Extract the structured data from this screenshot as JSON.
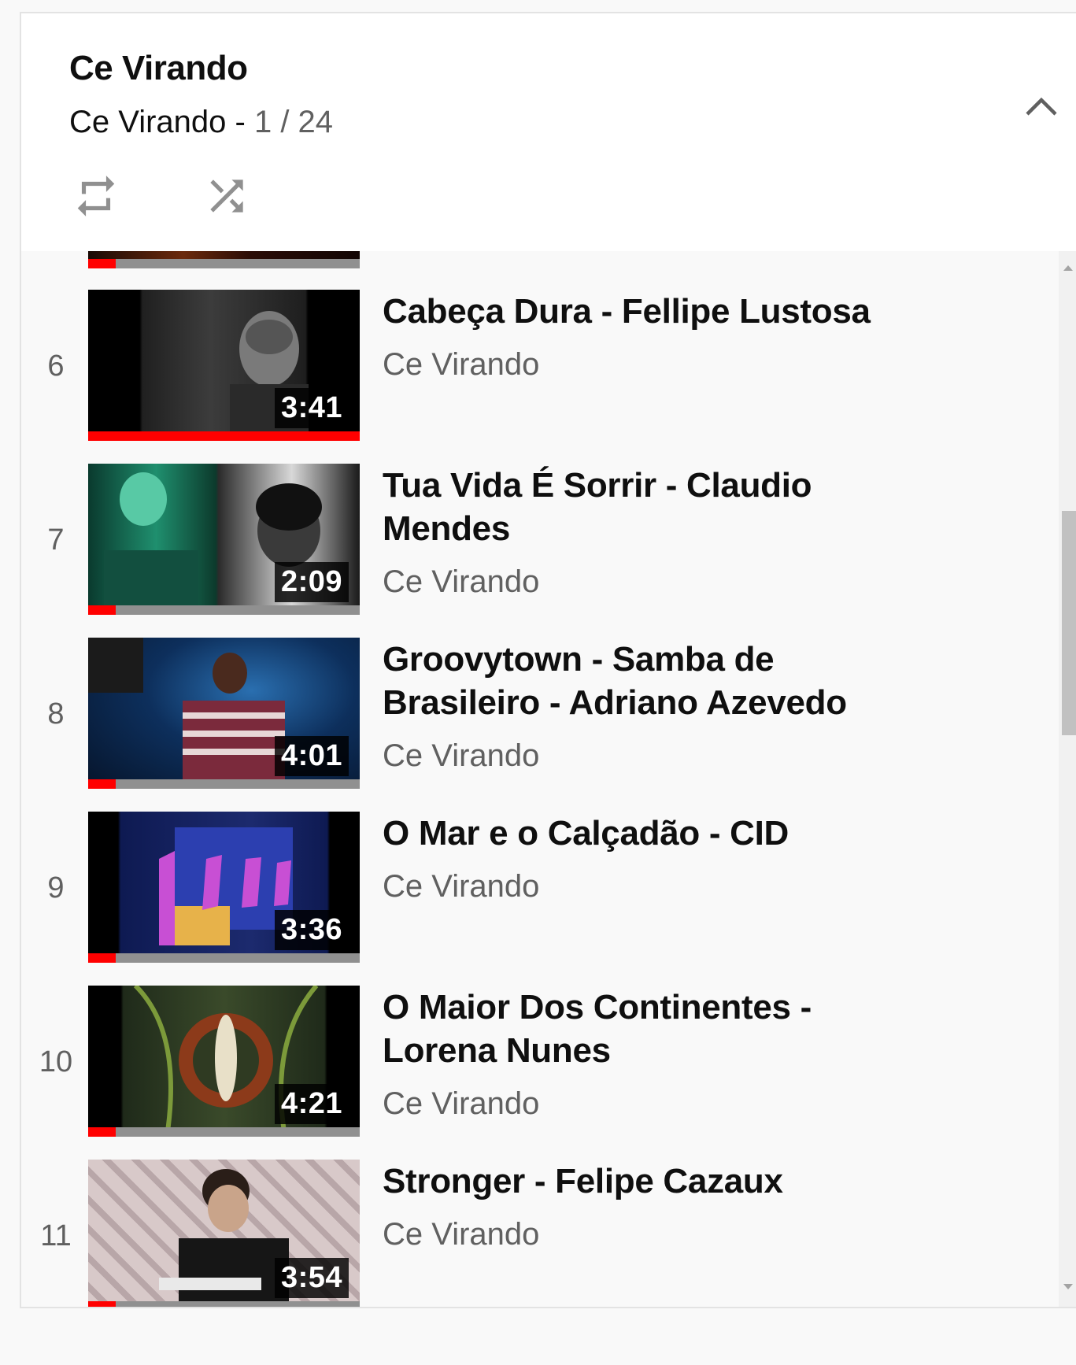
{
  "playlist": {
    "title": "Ce Virando",
    "channel": "Ce Virando",
    "separator": " - ",
    "position": "1 / 24",
    "controls": {
      "loop_icon": "loop-icon",
      "shuffle_icon": "shuffle-icon",
      "collapse_icon": "chevron-up-icon"
    }
  },
  "items": [
    {
      "index": "6",
      "title": "Cabeça Dura - Fellipe Lustosa",
      "channel": "Ce Virando",
      "duration": "3:41",
      "watched_fraction": 1.0
    },
    {
      "index": "7",
      "title": "Tua Vida É Sorrir - Claudio Mendes",
      "channel": "Ce Virando",
      "duration": "2:09",
      "watched_fraction": 0.1
    },
    {
      "index": "8",
      "title": "Groovytown - Samba de Brasileiro - Adriano Azevedo",
      "channel": "Ce Virando",
      "duration": "4:01",
      "watched_fraction": 0.1
    },
    {
      "index": "9",
      "title": "O Mar e o Calçadão - CID",
      "channel": "Ce Virando",
      "duration": "3:36",
      "watched_fraction": 0.1
    },
    {
      "index": "10",
      "title": "O Maior Dos Continentes - Lorena Nunes",
      "channel": "Ce Virando",
      "duration": "4:21",
      "watched_fraction": 0.1
    },
    {
      "index": "11",
      "title": "Stronger - Felipe Cazaux",
      "channel": "Ce Virando",
      "duration": "3:54",
      "watched_fraction": 0.1
    }
  ],
  "colors": {
    "progress_played": "#ff0000",
    "progress_track": "#909090"
  }
}
